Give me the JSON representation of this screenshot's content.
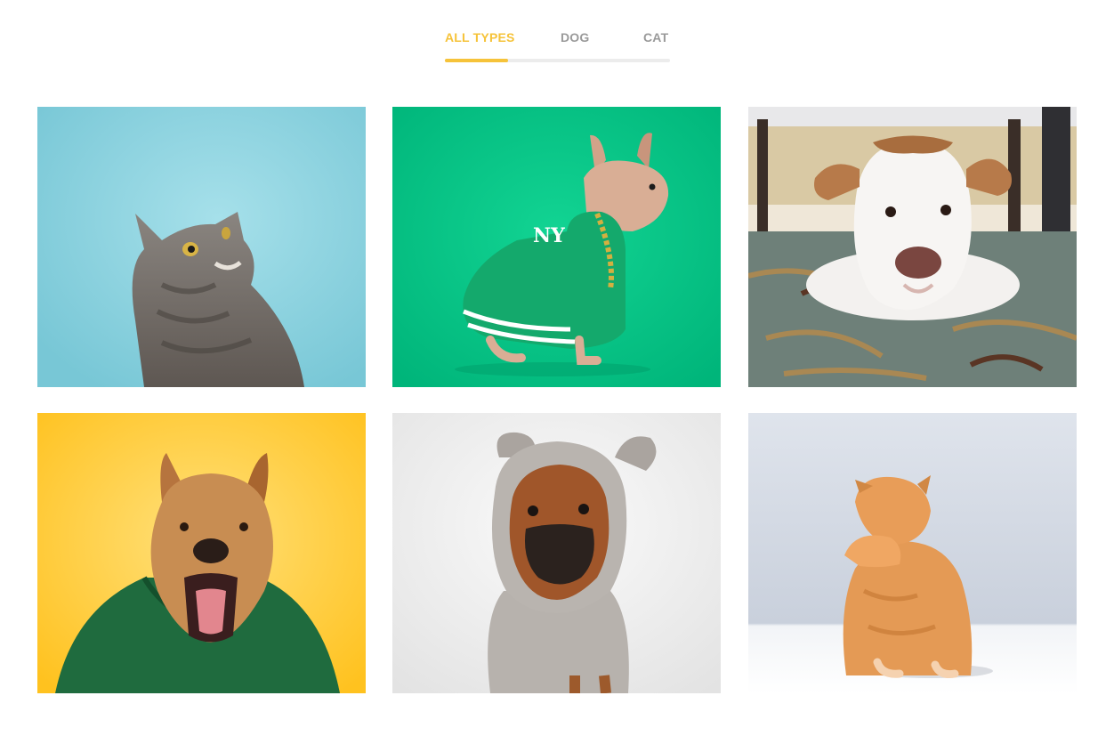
{
  "filter": {
    "tabs": [
      {
        "label": "ALL TYPES",
        "active": true
      },
      {
        "label": "DOG",
        "active": false
      },
      {
        "label": "CAT",
        "active": false
      }
    ],
    "accent_color": "#f6c33a",
    "inactive_color": "#9a9a9a",
    "track_color": "#ececec"
  },
  "gallery": {
    "items": [
      {
        "type": "cat",
        "subject": "grey tabby cat looking up",
        "background": "#8fd3df"
      },
      {
        "type": "dog",
        "subject": "french bulldog in green jacket with gold chain",
        "background": "#00c281"
      },
      {
        "type": "dog",
        "subject": "white pit bull lying on rug",
        "background": "#6f7f78"
      },
      {
        "type": "dog",
        "subject": "brown dog in green bomber jacket yawning",
        "background": "#ffc62c"
      },
      {
        "type": "dog",
        "subject": "pug in grey mouse-ear hoodie",
        "background": "#eeeeee"
      },
      {
        "type": "cat",
        "subject": "orange kitten covering face with paw",
        "background": "#d7dde8"
      }
    ]
  }
}
